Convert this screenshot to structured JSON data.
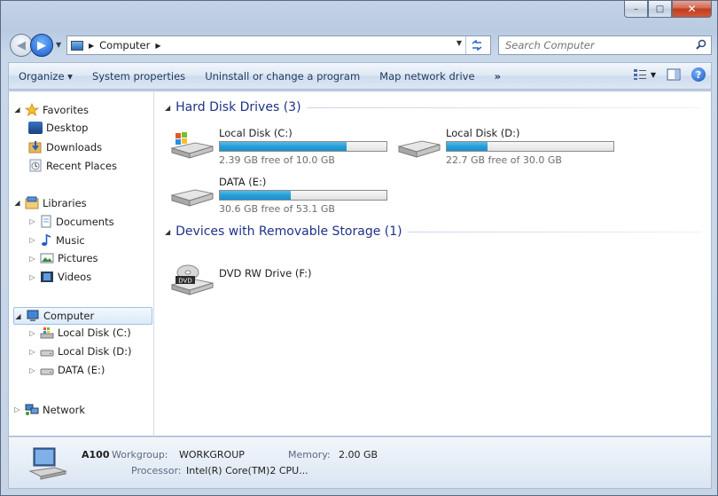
{
  "window": {
    "caption": {
      "minimize": "–",
      "maximize": "□",
      "close": "✕"
    }
  },
  "addressbar": {
    "breadcrumb": [
      "Computer"
    ],
    "search_placeholder": "Search Computer"
  },
  "toolbar": {
    "items": [
      "Organize ▾",
      "System properties",
      "Uninstall or change a program",
      "Map network drive",
      "»"
    ]
  },
  "nav": {
    "favorites": {
      "label": "Favorites",
      "items": [
        "Desktop",
        "Downloads",
        "Recent Places"
      ]
    },
    "libraries": {
      "label": "Libraries",
      "items": [
        "Documents",
        "Music",
        "Pictures",
        "Videos"
      ]
    },
    "computer": {
      "label": "Computer",
      "items": [
        "Local Disk (C:)",
        "Local Disk (D:)",
        "DATA (E:)"
      ]
    },
    "network": {
      "label": "Network"
    }
  },
  "groups": {
    "hdd": {
      "title": "Hard Disk Drives (3)"
    },
    "removable": {
      "title": "Devices with Removable Storage (1)"
    }
  },
  "drives": [
    {
      "name": "Local Disk (C:)",
      "free": "2.39 GB free of 10.0 GB",
      "used_fraction": 0.761
    },
    {
      "name": "Local Disk (D:)",
      "free": "22.7 GB free of 30.0 GB",
      "used_fraction": 0.243
    },
    {
      "name": "DATA (E:)",
      "free": "30.6 GB free of 53.1 GB",
      "used_fraction": 0.424
    }
  ],
  "removable": [
    {
      "name": "DVD RW Drive (F:)",
      "icon_label": "DVD"
    }
  ],
  "details": {
    "name": "A100",
    "workgroup_label": "Workgroup:",
    "workgroup": "WORKGROUP",
    "memory_label": "Memory:",
    "memory": "2.00 GB",
    "processor_label": "Processor:",
    "processor": "Intel(R) Core(TM)2 CPU..."
  },
  "colors": {
    "accent": "#26a0da",
    "group_title": "#1e3287",
    "toolbar_text": "#1e395b"
  }
}
